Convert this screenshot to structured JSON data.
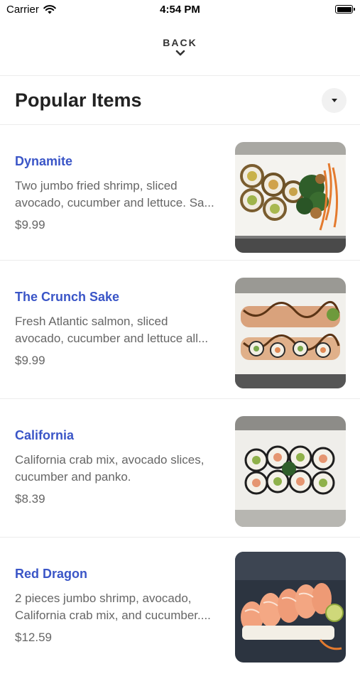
{
  "status": {
    "carrier": "Carrier",
    "time": "4:54 PM"
  },
  "nav": {
    "back_label": "BACK"
  },
  "section": {
    "title": "Popular Items"
  },
  "items": [
    {
      "name": "Dynamite",
      "description": "Two jumbo fried shrimp, sliced\navocado, cucumber and lettuce. Sa...",
      "price": "$9.99",
      "image": "dynamite-roll-photo"
    },
    {
      "name": "The Crunch Sake",
      "description": "Fresh Atlantic salmon, sliced\navocado, cucumber and lettuce all...",
      "price": "$9.99",
      "image": "crunch-sake-roll-photo"
    },
    {
      "name": "California",
      "description": "California crab mix, avocado slices,\ncucumber and panko.",
      "price": "$8.39",
      "image": "california-roll-photo"
    },
    {
      "name": "Red Dragon",
      "description": "2 pieces jumbo shrimp, avocado,\nCalifornia crab mix, and cucumber....",
      "price": "$12.59",
      "image": "red-dragon-roll-photo"
    }
  ],
  "colors": {
    "item_name": "#3a55c7",
    "text_muted": "#666666",
    "divider": "#ececec"
  }
}
